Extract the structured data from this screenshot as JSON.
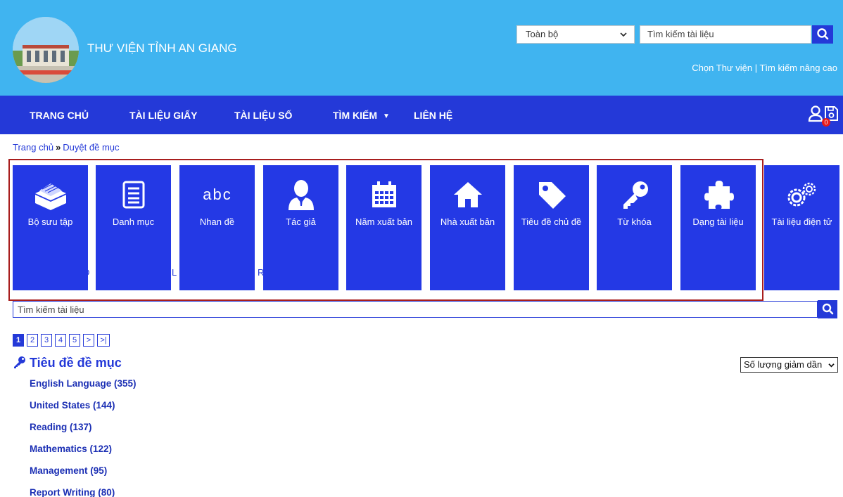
{
  "header": {
    "site_title": "THƯ VIỆN TỈNH AN GIANG",
    "scope_value": "Toàn bộ",
    "search_placeholder": "Tìm kiếm tài liệu",
    "links": "Chọn Thư viện | Tìm kiếm nâng cao"
  },
  "nav": {
    "items": [
      {
        "label": "TRANG CHỦ"
      },
      {
        "label": "TÀI LIỆU GIẤY"
      },
      {
        "label": "TÀI LIỆU SỐ"
      },
      {
        "label": "TÌM KIẾM"
      },
      {
        "label": "LIÊN HỆ"
      }
    ],
    "cart_count": "0"
  },
  "breadcrumb": {
    "home": "Trang chủ",
    "separator": "»",
    "current": "Duyệt đề mục"
  },
  "tiles": [
    {
      "label": "Bộ sưu tập",
      "icon": "box-icon"
    },
    {
      "label": "Danh mục",
      "icon": "list-icon"
    },
    {
      "label": "Nhan đề",
      "icon": "abc-icon"
    },
    {
      "label": "Tác giả",
      "icon": "person-icon"
    },
    {
      "label": "Năm xuất bản",
      "icon": "calendar-icon"
    },
    {
      "label": "Nhà xuất bản",
      "icon": "house-icon"
    },
    {
      "label": "Tiêu đề chủ đề",
      "icon": "tag-icon"
    },
    {
      "label": "Từ khóa",
      "icon": "key-icon"
    },
    {
      "label": "Dạng tài liệu",
      "icon": "puzzle-icon"
    },
    {
      "label": "Tài liệu điện tử",
      "icon": "gears-icon"
    }
  ],
  "ghost_text": {
    "a": "D",
    "b": "L",
    "c": "R"
  },
  "search": {
    "placeholder": "Tìm kiếm tài liệu"
  },
  "pager": {
    "pages": [
      "1",
      "2",
      "3",
      "4",
      "5",
      ">",
      ">|"
    ],
    "current": "1"
  },
  "list": {
    "title": "Tiêu đề đề mục",
    "sort_value": "Số lượng giảm dần",
    "items": [
      "English Language (355)",
      "United States (144)",
      "Reading (137)",
      "Mathematics (122)",
      "Management (95)",
      "Report Writing (80)"
    ]
  },
  "colors": {
    "header_bg": "#40b4f0",
    "nav_bg": "#2439d8",
    "tile_bg": "#2439e5",
    "frame": "#a81e1e",
    "badge": "#e81818"
  }
}
